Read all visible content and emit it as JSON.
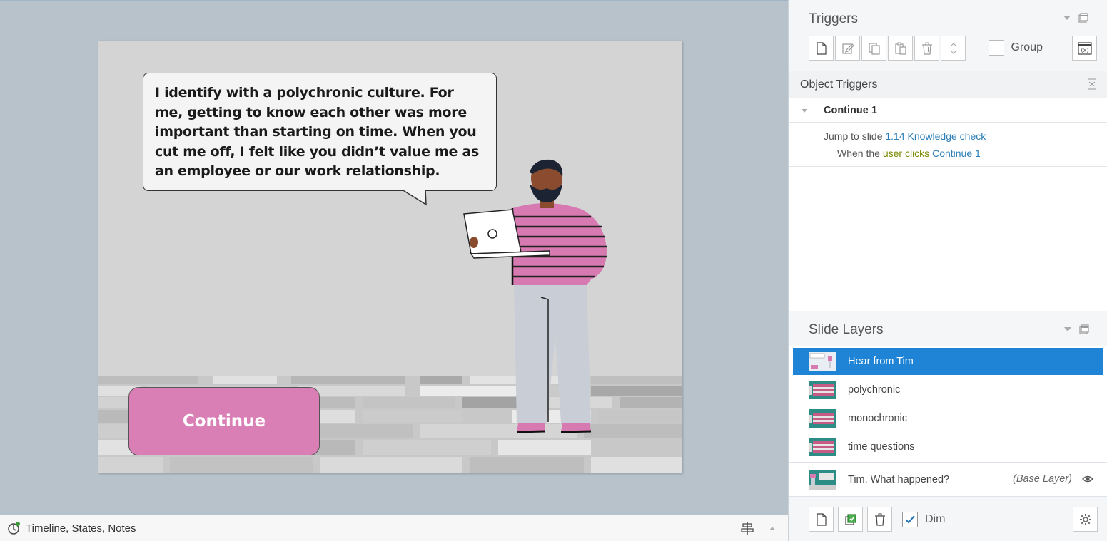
{
  "slide": {
    "bubble_text": "I identify with a polychronic culture. For me, getting to know each other was more important than starting on time. When you cut me off, I felt like you didn’t value me as an employee or our work relationship.",
    "continue_label": "Continue"
  },
  "bottombar": {
    "label": "Timeline, States, Notes"
  },
  "triggers_panel": {
    "title": "Triggers",
    "group_label": "Group",
    "object_triggers_title": "Object Triggers",
    "trigger_name": "Continue 1",
    "action_prefix": "Jump to slide",
    "action_target": "1.14 Knowledge check",
    "condition_prefix": "When the",
    "condition_keyword": "user clicks",
    "condition_object": "Continue 1"
  },
  "layers_panel": {
    "title": "Slide Layers",
    "layers": [
      {
        "name": "Hear from Tim",
        "selected": true
      },
      {
        "name": "polychronic",
        "selected": false
      },
      {
        "name": "monochronic",
        "selected": false
      },
      {
        "name": "time questions",
        "selected": false
      }
    ],
    "base_layer_name": "Tim. What happened?",
    "base_layer_tag": "(Base Layer)",
    "dim_label": "Dim"
  },
  "colors": {
    "accent": "#1f84d6",
    "button_pink": "#d97fb5",
    "shirt_pink": "#d77ab2",
    "link": "#2c7fb8"
  }
}
